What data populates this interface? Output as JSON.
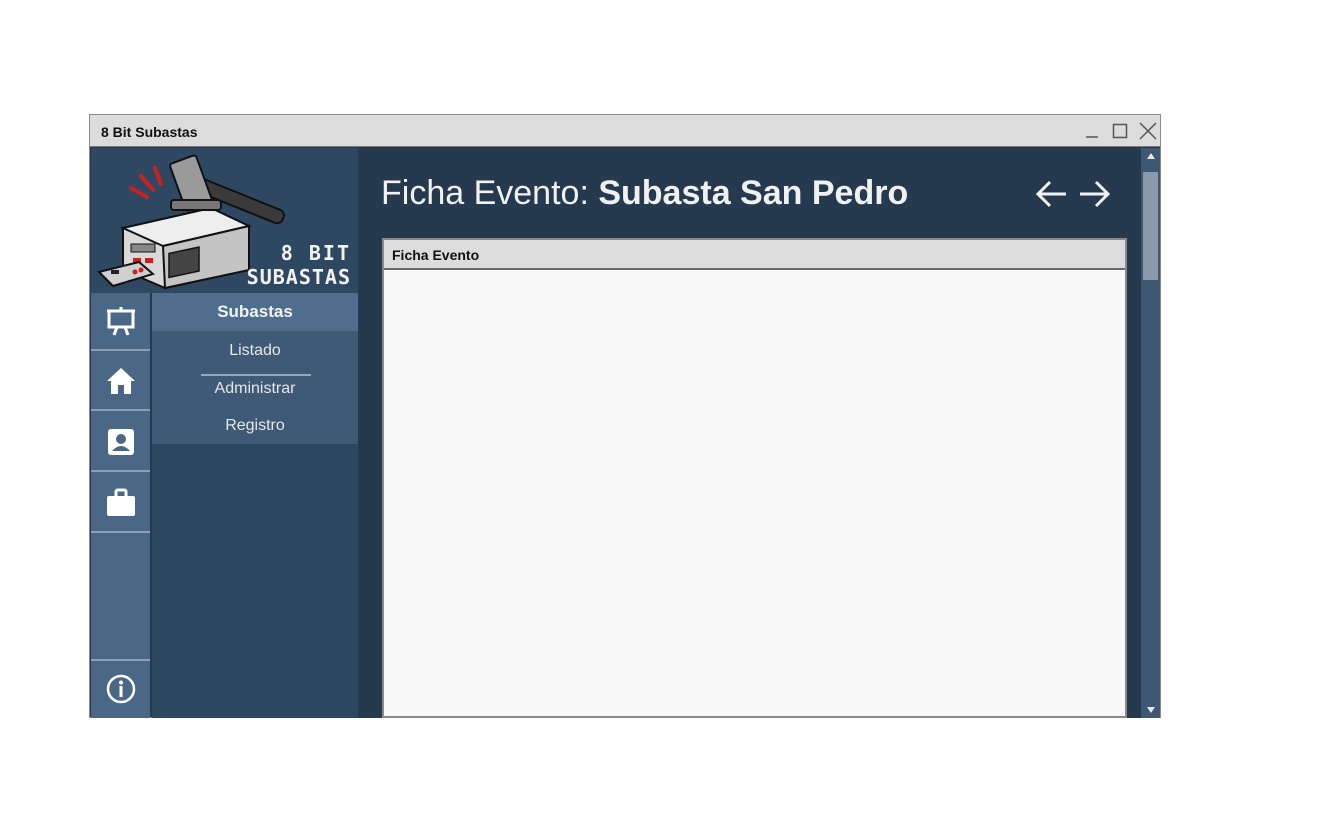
{
  "window": {
    "title": "8 Bit Subastas",
    "controls": [
      "minimize-icon",
      "maximize-icon",
      "close-icon"
    ]
  },
  "logo": {
    "line1": "8 BIT",
    "line2": "SUBASTAS",
    "image": "gavel-on-retro-console-logo"
  },
  "iconbar": {
    "items": [
      {
        "icon": "presentation-board-icon",
        "label": ""
      },
      {
        "icon": "home-icon",
        "label": ""
      },
      {
        "icon": "contact-card-icon",
        "label": ""
      },
      {
        "icon": "briefcase-icon",
        "label": ""
      }
    ],
    "bottom": {
      "icon": "info-icon"
    }
  },
  "submenu": {
    "heading": "Subastas",
    "items": [
      {
        "label": "Listado",
        "active": true
      },
      {
        "label": "Administrar",
        "active": false
      },
      {
        "label": "Registro",
        "active": false
      }
    ]
  },
  "main": {
    "heading_prefix": "Ficha Evento:",
    "heading_name": "Subasta San Pedro",
    "nav": {
      "back_icon": "arrow-left-icon",
      "forward_icon": "arrow-right-icon"
    },
    "panel": {
      "title": "Ficha Evento"
    }
  },
  "colors": {
    "main_bg": "#263a4f",
    "iconbar_bg": "#4a6785",
    "submenu_bg": "#2d4761",
    "submenu_head_bg": "#4f6d8d",
    "titlebar_bg": "#dcdcdc"
  }
}
